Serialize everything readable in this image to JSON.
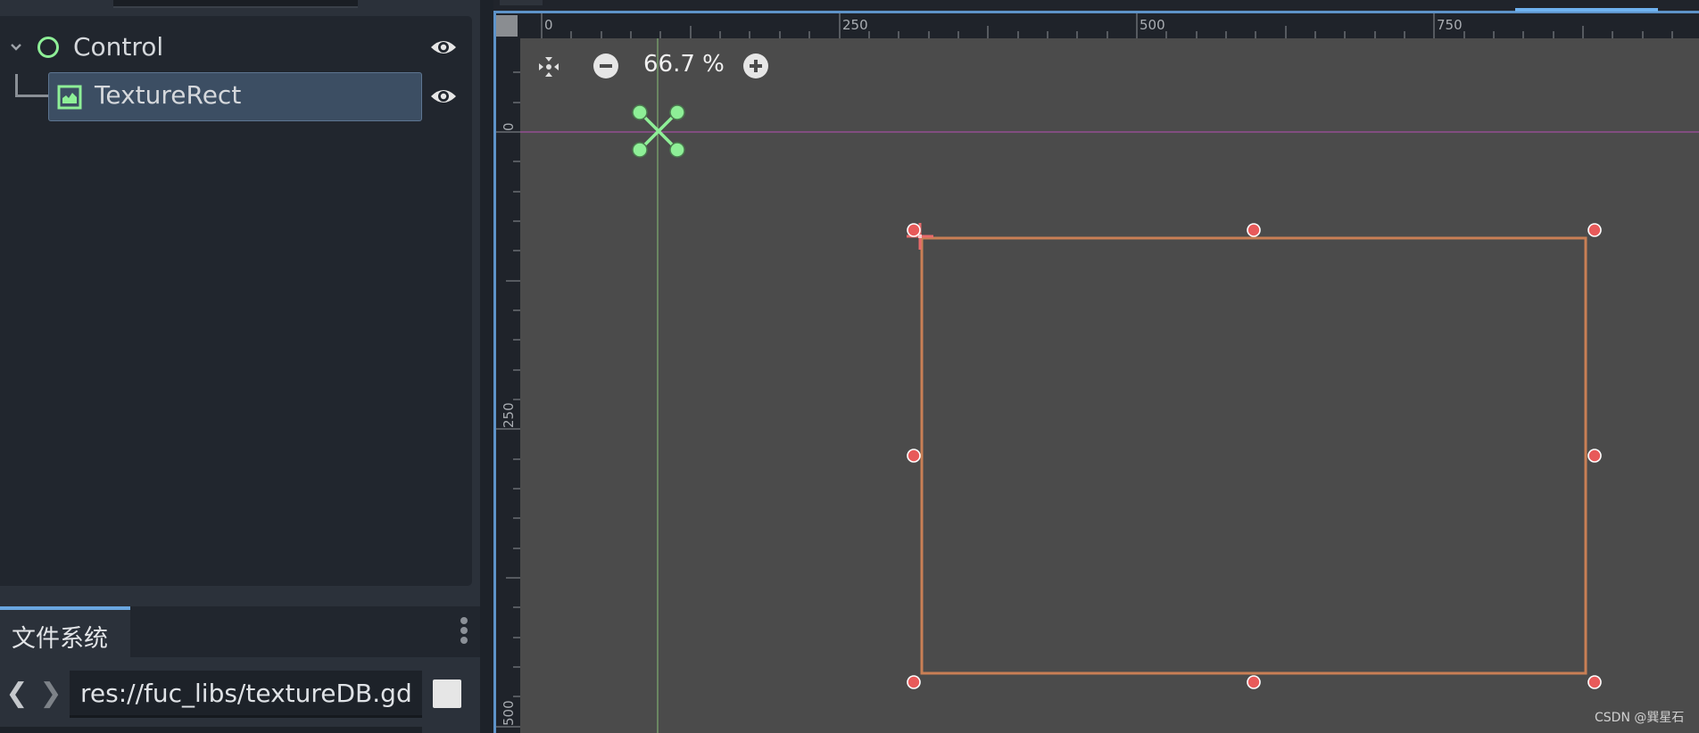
{
  "scene_tree": {
    "nodes": [
      {
        "label": "Control",
        "icon": "control-node-icon",
        "visible": true
      },
      {
        "label": "TextureRect",
        "icon": "texture-rect-icon",
        "visible": true,
        "selected": true
      }
    ]
  },
  "filesystem": {
    "tab_label": "文件系统",
    "back_label": "❮",
    "forward_label": "❯",
    "path_value": "res://fuc_libs/textureDB.gd"
  },
  "viewport": {
    "zoom_label": "66.7 %",
    "ruler_h_labels": [
      "0",
      "250",
      "500",
      "750"
    ],
    "ruler_v_labels": [
      "0",
      "250",
      "500"
    ]
  },
  "colors": {
    "accent": "#6aa6e0",
    "node_green": "#8eef97",
    "selection_rect": "#c97f55",
    "handle": "#e85a5a"
  },
  "watermark": "CSDN @巽星石"
}
